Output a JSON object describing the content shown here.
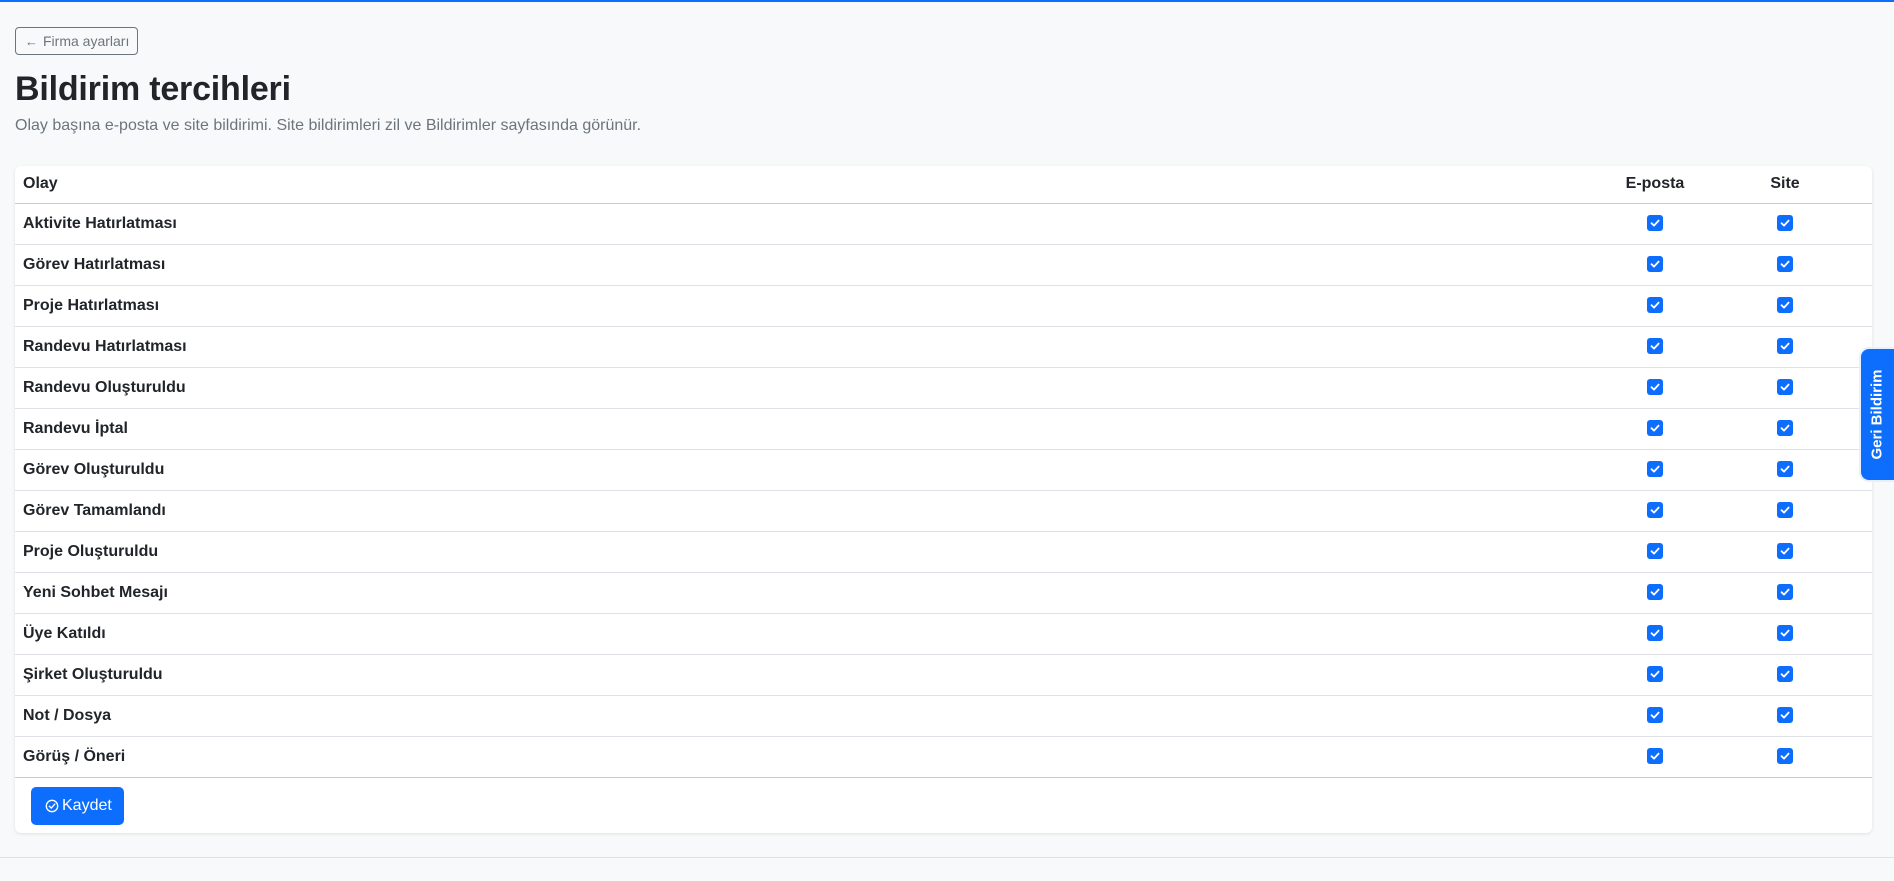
{
  "header": {
    "back_button_label": "Firma ayarları",
    "title": "Bildirim tercihleri",
    "subtitle": "Olay başına e-posta ve site bildirimi. Site bildirimleri zil ve Bildirimler sayfasında görünür."
  },
  "table": {
    "columns": {
      "event": "Olay",
      "email": "E-posta",
      "site": "Site"
    },
    "rows": [
      {
        "event": "Aktivite Hatırlatması",
        "email": true,
        "site": true
      },
      {
        "event": "Görev Hatırlatması",
        "email": true,
        "site": true
      },
      {
        "event": "Proje Hatırlatması",
        "email": true,
        "site": true
      },
      {
        "event": "Randevu Hatırlatması",
        "email": true,
        "site": true
      },
      {
        "event": "Randevu Oluşturuldu",
        "email": true,
        "site": true
      },
      {
        "event": "Randevu İptal",
        "email": true,
        "site": true
      },
      {
        "event": "Görev Oluşturuldu",
        "email": true,
        "site": true
      },
      {
        "event": "Görev Tamamlandı",
        "email": true,
        "site": true
      },
      {
        "event": "Proje Oluşturuldu",
        "email": true,
        "site": true
      },
      {
        "event": "Yeni Sohbet Mesajı",
        "email": true,
        "site": true
      },
      {
        "event": "Üye Katıldı",
        "email": true,
        "site": true
      },
      {
        "event": "Şirket Oluşturuldu",
        "email": true,
        "site": true
      },
      {
        "event": "Not / Dosya",
        "email": true,
        "site": true
      },
      {
        "event": "Görüş / Öneri",
        "email": true,
        "site": true
      }
    ]
  },
  "actions": {
    "save_label": "Kaydet"
  },
  "feedback_tab": {
    "label": "Geri Bildirim"
  },
  "footer": {
    "text": ""
  },
  "colors": {
    "accent": "#0d6efd",
    "background": "#f8f9fa",
    "muted": "#6c757d"
  }
}
